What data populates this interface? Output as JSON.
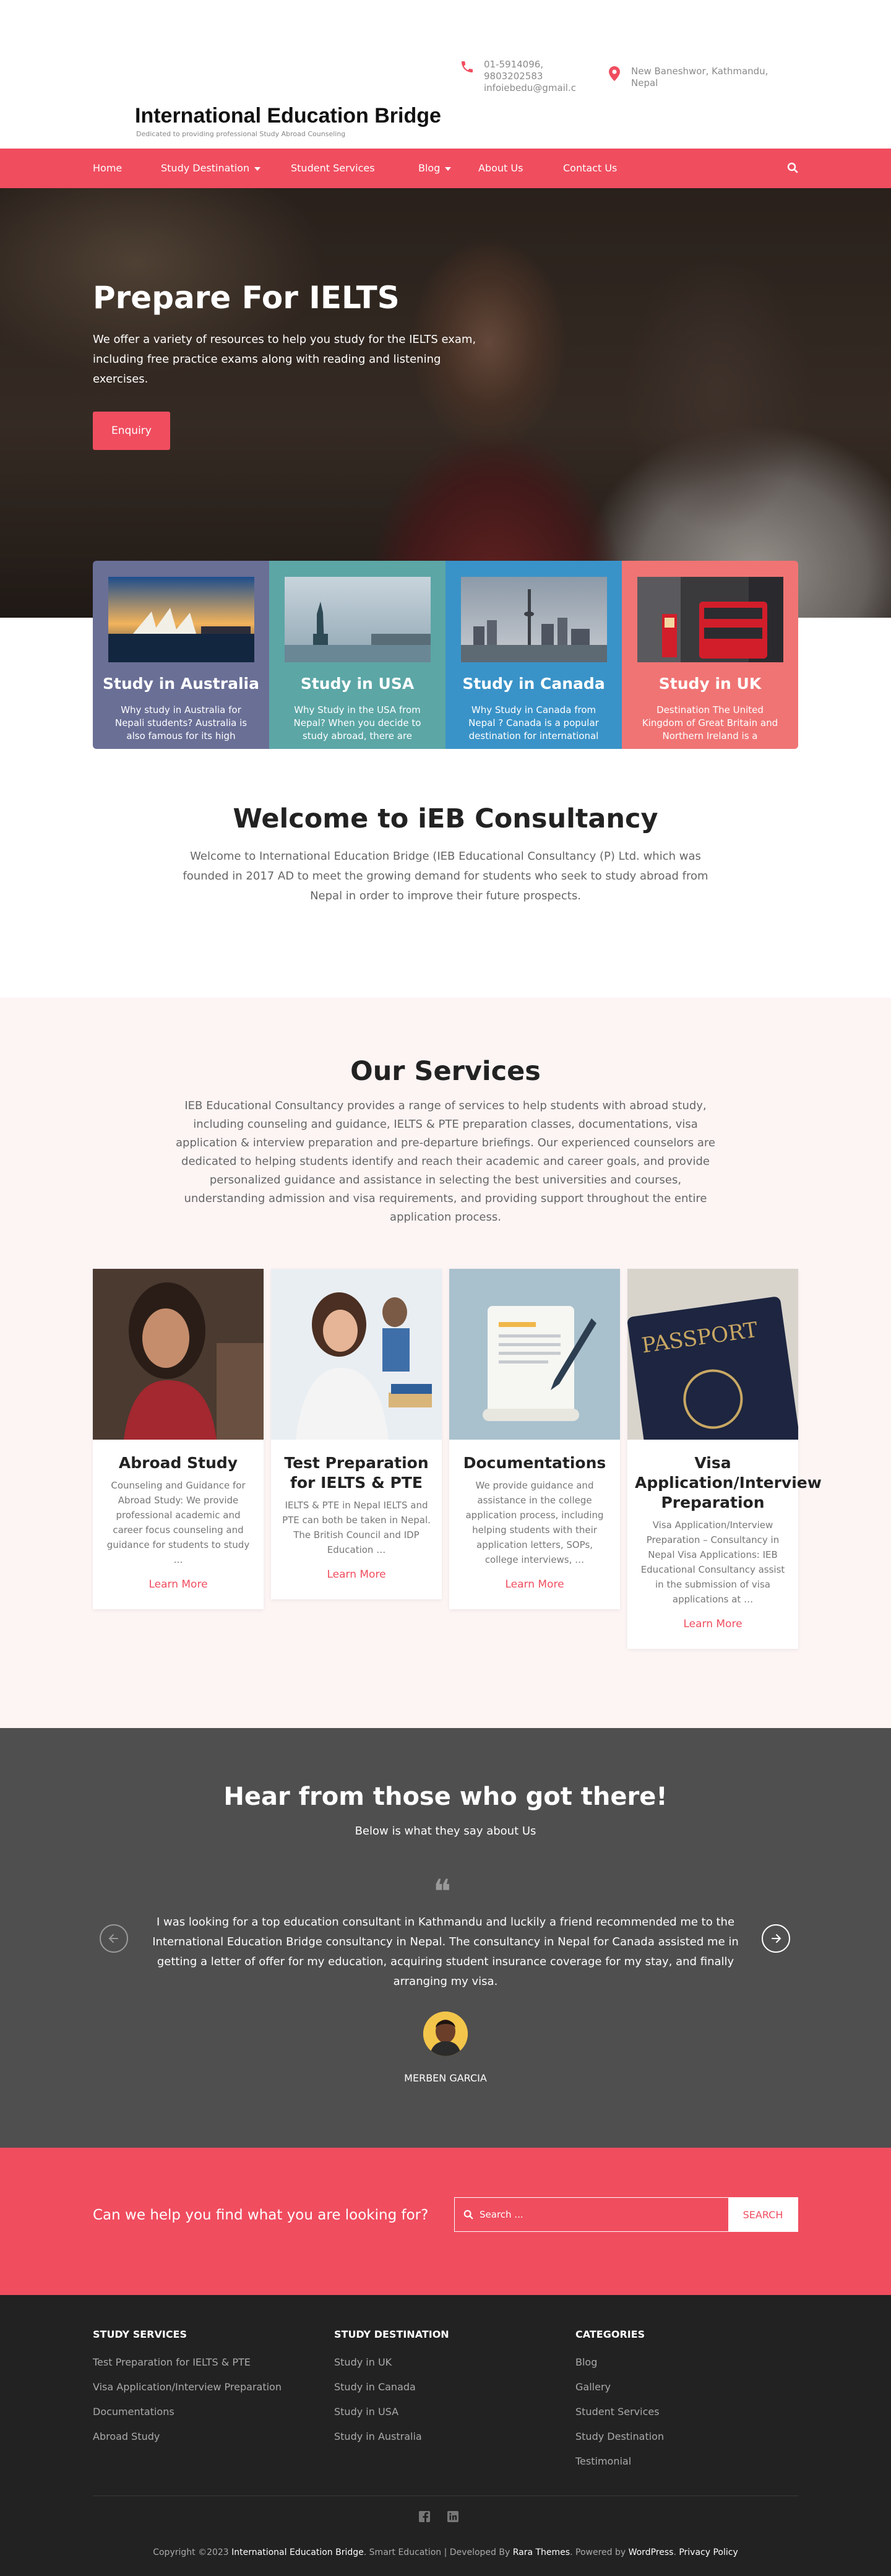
{
  "header": {
    "site_title": "International Education Bridge",
    "tagline": "Dedicated to providing professional Study Abroad Counseling",
    "phone_lines": [
      "01-5914096,",
      "9803202583",
      "infoiebedu@gmail.c"
    ],
    "address_lines": [
      "New Baneshwor, Kathmandu,",
      "Nepal"
    ],
    "icons": {
      "phone": "phone-icon",
      "location": "map-pin-icon"
    }
  },
  "nav": {
    "items": [
      "Home",
      "Study Destination",
      "Student Services",
      "Blog",
      "About Us",
      "Contact Us"
    ],
    "search_icon": "search-icon"
  },
  "hero": {
    "title": "Prepare For IELTS",
    "text": "We offer a variety of resources to help you study for the IELTS exam, including free practice exams along with reading and listening exercises.",
    "button": "Enquiry"
  },
  "destinations": [
    {
      "title": "Study in Australia",
      "text": "Why study in Australia for Nepali students? Australia is also famous for its high",
      "color": "#6a6f96"
    },
    {
      "title": "Study in USA",
      "text": "Why Study in the USA from Nepal? When you decide to study abroad, there are",
      "color": "#5ca6a6"
    },
    {
      "title": "Study in Canada",
      "text": "Why Study in Canada from Nepal ? Canada is a popular destination for international",
      "color": "#3a93c8"
    },
    {
      "title": "Study in UK",
      "text": "Destination The United Kingdom of Great Britain and Northern Ireland is a",
      "color": "#f07474"
    }
  ],
  "welcome": {
    "title": "Welcome to iEB Consultancy",
    "text": "Welcome to International Education Bridge (IEB Educational Consultancy (P) Ltd. which was founded in 2017 AD to meet the growing demand for students who seek to study abroad from Nepal in order to improve their future prospects."
  },
  "services": {
    "title": "Our Services",
    "text": "IEB Educational Consultancy provides a range of services to help students with abroad study, including counseling and guidance, IELTS & PTE preparation classes, documentations, visa application & interview preparation and pre-departure briefings. Our experienced counselors are dedicated to helping students identify and reach their academic and career goals, and provide personalized guidance and assistance in selecting the best universities and courses, understanding admission and visa requirements, and providing support throughout the entire application process.",
    "items": [
      {
        "title": "Abroad Study",
        "text": "Counseling and Guidance for Abroad Study: We provide professional academic and career focus counseling and guidance for students to study …",
        "link": "Learn More"
      },
      {
        "title": "Test Preparation for IELTS & PTE",
        "text": "IELTS & PTE in Nepal IELTS and PTE can both be taken in Nepal. The British Council and IDP Education …",
        "link": "Learn More"
      },
      {
        "title": "Documentations",
        "text": "We provide guidance and assistance in the college application process, including helping students with their application letters, SOPs, college interviews, …",
        "link": "Learn More"
      },
      {
        "title": "Visa Application/Interview Preparation",
        "text": "Visa Application/Interview Preparation – Consultancy in Nepal Visa Applications: IEB Educational Consultancy assist in the submission of visa applications at …",
        "link": "Learn More"
      }
    ]
  },
  "testimonials": {
    "title": "Hear from those who got there!",
    "subtitle": "Below is what they say about Us",
    "quote": "I was looking for a top education consultant in Kathmandu and luckily a friend recommended me to the International Education Bridge consultancy in Nepal. The consultancy in Nepal for Canada assisted me in getting a letter of offer for my education, acquiring student insurance coverage for my stay, and finally arranging my visa.",
    "name": "MERBEN GARCIA",
    "quote_mark": "❝"
  },
  "cta": {
    "text": "Can we help you find what you are looking for?",
    "placeholder": "Search ...",
    "button": "SEARCH"
  },
  "footer": {
    "columns": [
      {
        "heading": "STUDY SERVICES",
        "links": [
          "Test Preparation for IELTS & PTE",
          "Visa Application/Interview Preparation",
          "Documentations",
          "Abroad Study"
        ]
      },
      {
        "heading": "STUDY DESTINATION",
        "links": [
          "Study in UK",
          "Study in Canada",
          "Study in USA",
          "Study in Australia"
        ]
      },
      {
        "heading": "CATEGORIES",
        "links": [
          "Blog",
          "Gallery",
          "Student Services",
          "Study Destination",
          "Testimonial"
        ]
      }
    ],
    "social_icons": [
      "facebook-icon",
      "linkedin-icon"
    ],
    "copyright_prefix": "Copyright ©2023",
    "copyright_site": "International Education Bridge",
    "copyright_mid": ". Smart Education | Developed By",
    "developer": "Rara Themes",
    "powered_prefix": ". Powered by",
    "powered": "WordPress",
    "privacy": "Privacy Policy"
  },
  "colors": {
    "accent": "#f04d5f",
    "dark": "#222222",
    "testimonial_bg": "#4f4f4f",
    "services_bg": "#fdf4f4"
  }
}
